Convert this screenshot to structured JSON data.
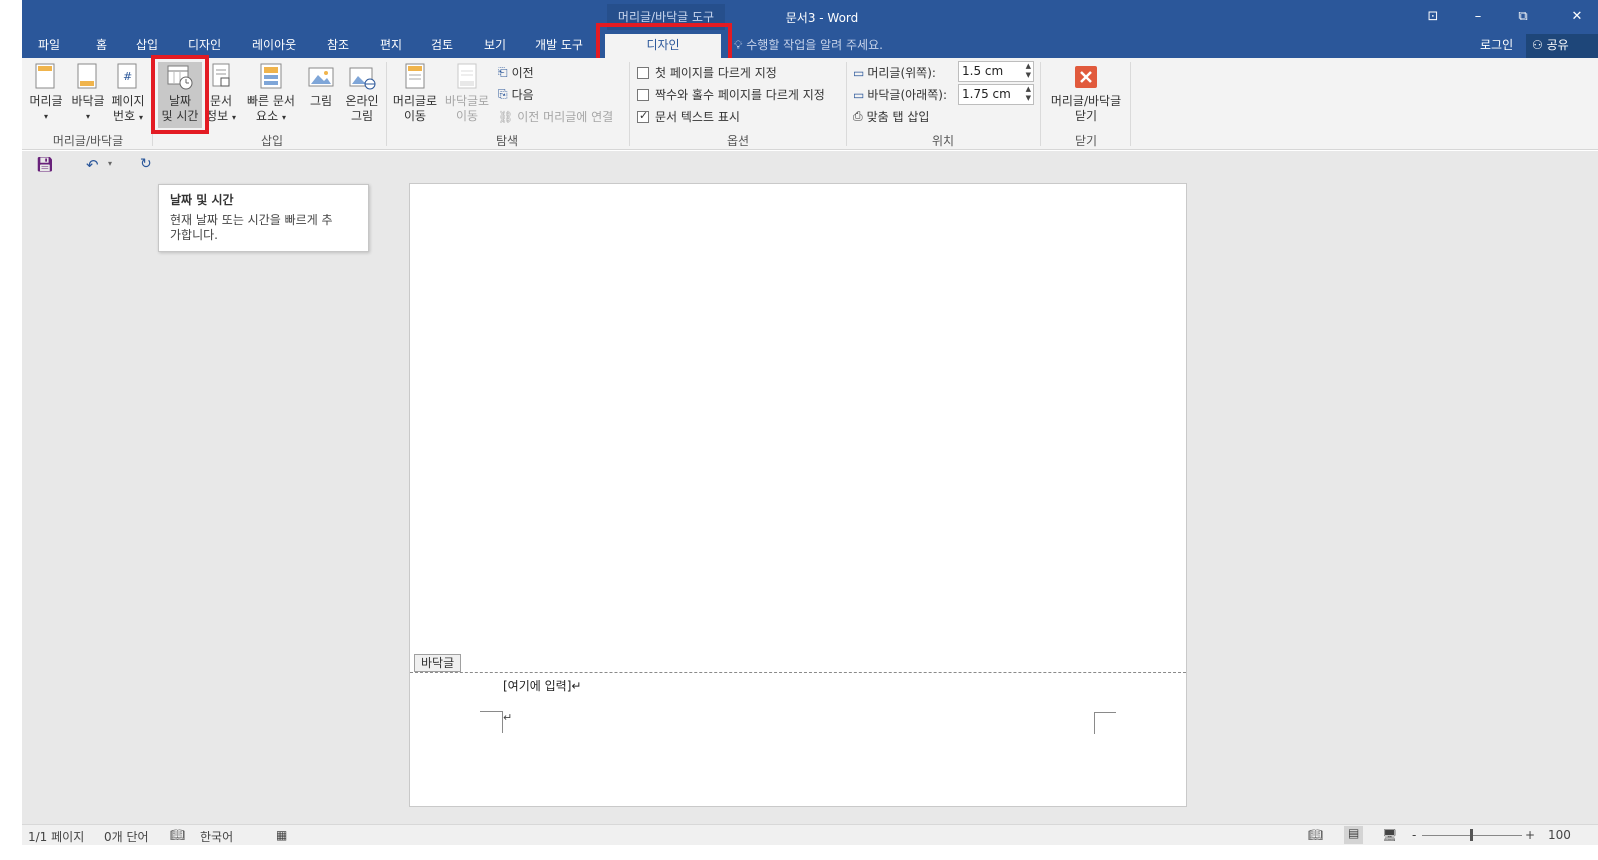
{
  "title_bar": {
    "context_tool": "머리글/바닥글 도구",
    "doc_title": "문서3 - Word",
    "restore_ribbon": "⊡",
    "minimize": "–",
    "restore": "⧉",
    "close": "✕"
  },
  "tabs": [
    {
      "label": "파일"
    },
    {
      "label": "홈"
    },
    {
      "label": "삽입"
    },
    {
      "label": "디자인"
    },
    {
      "label": "레이아웃"
    },
    {
      "label": "참조"
    },
    {
      "label": "편지"
    },
    {
      "label": "검토"
    },
    {
      "label": "보기"
    },
    {
      "label": "개발 도구"
    },
    {
      "label": "디자인",
      "active": true
    }
  ],
  "tell_me": "수행할 작업을 알려 주세요.",
  "login": "로그인",
  "share": "공유",
  "ribbon": {
    "header_btn": "머리글",
    "footer_btn": "바닥글",
    "page_num_btn_1": "페이지",
    "page_num_btn_2": "번호",
    "group_header_footer": "머리글/바닥글",
    "date_time_1": "날짜",
    "date_time_2": "및 시간",
    "doc_info_1": "문서",
    "doc_info_2": "정보",
    "quick_parts_1": "빠른 문서",
    "quick_parts_2": "요소",
    "picture": "그림",
    "online_pic_1": "온라인",
    "online_pic_2": "그림",
    "group_insert": "삽입",
    "go_header_1": "머리글로",
    "go_header_2": "이동",
    "go_footer_1": "바닥글로",
    "go_footer_2": "이동",
    "prev": "이전",
    "next": "다음",
    "link_prev": "이전 머리글에 연결",
    "group_nav": "탐색",
    "opt_first_page": "첫 페이지를 다르게 지정",
    "opt_odd_even": "짝수와 홀수 페이지를 다르게 지정",
    "opt_show_text": "문서 텍스트 표시",
    "group_options": "옵션",
    "header_pos_label": "머리글(위쪽):",
    "header_pos_value": "1.5 cm",
    "footer_pos_label": "바닥글(아래쪽):",
    "footer_pos_value": "1.75 cm",
    "align_tab": "맞춤 탭 삽입",
    "group_position": "위치",
    "close_1": "머리글/바닥글",
    "close_2": "닫기",
    "group_close": "닫기"
  },
  "tooltip": {
    "title": "날짜 및 시간",
    "body": "현재 날짜 또는 시간을 빠르게 추가합니다."
  },
  "document": {
    "footer_tag": "바닥글",
    "footer_placeholder": "[여기에 입력]↵",
    "paragraph_mark": "↵"
  },
  "status": {
    "page": "1/1 페이지",
    "words": "0개 단어",
    "language": "한국어",
    "zoom": "100"
  },
  "colors": {
    "accent": "#2b579a",
    "highlight": "#e31b23"
  }
}
